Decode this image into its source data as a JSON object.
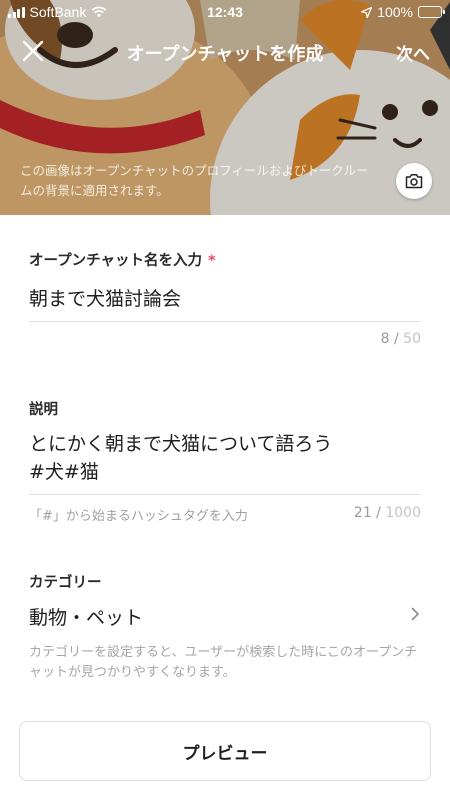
{
  "status_bar": {
    "carrier": "SoftBank",
    "time": "12:43",
    "battery": "100%",
    "battery_level": 1.0,
    "icons": [
      "signal-icon",
      "wifi-icon",
      "location-arrow-icon",
      "battery-icon"
    ]
  },
  "header": {
    "title": "オープンチャットを作成",
    "close_icon": "close-icon",
    "next_label": "次へ",
    "background_note": "この画像はオープンチャットのプロフィールおよびトークルームの背景に適用されます。",
    "camera_icon": "camera-icon"
  },
  "form": {
    "name": {
      "label": "オープンチャット名を入力",
      "required_mark": "*",
      "value": "朝まで犬猫討論会",
      "count": "8",
      "max": "50"
    },
    "description": {
      "label": "説明",
      "value_line1": "とにかく朝まで犬猫について語ろう",
      "value_line2": "#犬#猫",
      "hint": "「#」から始まるハッシュタグを入力",
      "count": "21",
      "max": "1000"
    },
    "category": {
      "label": "カテゴリー",
      "value": "動物・ペット",
      "chevron_icon": "chevron-right-icon",
      "note": "カテゴリーを設定すると、ユーザーが検索した時にこのオープンチャットが見つかりやすくなります。"
    }
  },
  "footer": {
    "preview_label": "プレビュー"
  },
  "colors": {
    "required": "#e84a5f",
    "counter": "#9a9a9a",
    "hint": "#a0a0a0"
  }
}
